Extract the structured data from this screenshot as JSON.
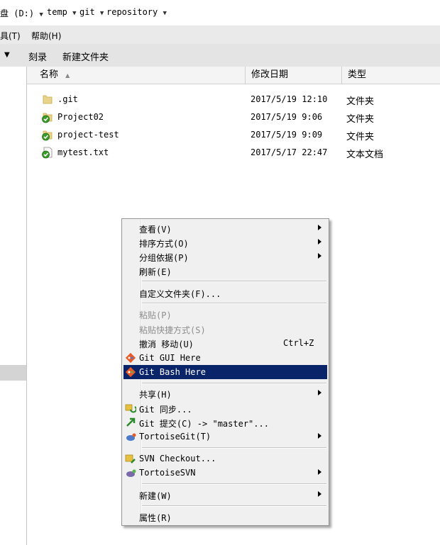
{
  "address": {
    "drive": "盘 (D:)",
    "path": [
      "temp",
      "git",
      "repository"
    ]
  },
  "menubar": {
    "tools": "具(T)",
    "help": "帮助(H)"
  },
  "toolbar": {
    "burn": "刻录",
    "new_folder": "新建文件夹"
  },
  "columns": {
    "name": "名称",
    "modified": "修改日期",
    "type": "类型"
  },
  "files": [
    {
      "name": ".git",
      "date": "2017/5/19 12:10",
      "type": "文件夹",
      "icon": "folder-icon"
    },
    {
      "name": "Project02",
      "date": "2017/5/19 9:06",
      "type": "文件夹",
      "icon": "tortoisegit-folder-icon"
    },
    {
      "name": "project-test",
      "date": "2017/5/19 9:09",
      "type": "文件夹",
      "icon": "tortoisegit-folder-icon"
    },
    {
      "name": "mytest.txt",
      "date": "2017/5/17 22:47",
      "type": "文本文档",
      "icon": "tortoisegit-file-icon"
    }
  ],
  "context_menu": {
    "view": "查看(V)",
    "sort_by": "排序方式(O)",
    "group_by": "分组依据(P)",
    "refresh": "刷新(E)",
    "customize_folder": "自定义文件夹(F)...",
    "paste": "粘贴(P)",
    "paste_shortcut": "粘贴快捷方式(S)",
    "undo_move": "撤消 移动(U)",
    "undo_shortcut": "Ctrl+Z",
    "git_gui": "Git GUI Here",
    "git_bash": "Git Bash Here",
    "share": "共享(H)",
    "git_sync": "Git 同步...",
    "git_commit": "Git 提交(C) -> \"master\"...",
    "tortoisegit": "TortoiseGit(T)",
    "svn_checkout": "SVN Checkout...",
    "tortoisesvn": "TortoiseSVN",
    "new": "新建(W)",
    "properties": "属性(R)"
  },
  "colors": {
    "highlight": "#0a246a",
    "menu_bg": "#f0f0f0",
    "disabled_text": "#8d8d8d"
  }
}
